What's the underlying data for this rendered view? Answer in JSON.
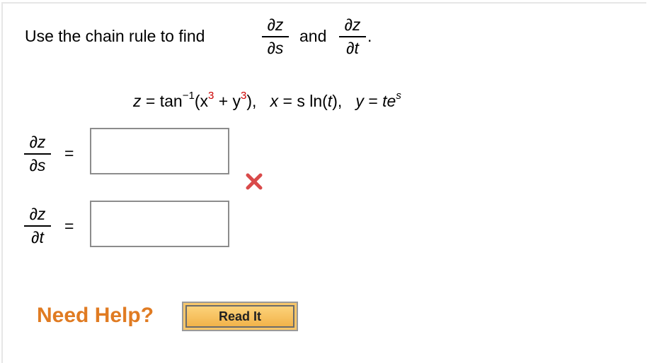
{
  "question": {
    "prompt_before": "Use the chain rule to find",
    "connector": "and",
    "period": ".",
    "frac_ds": {
      "num": "∂z",
      "den": "∂s"
    },
    "frac_dt": {
      "num": "∂z",
      "den": "∂t"
    }
  },
  "equation": {
    "z_lhs": "z",
    "eq": "=",
    "tan": "tan",
    "inv": "−1",
    "open": "(x",
    "exp_x": "3",
    "plus": "+ y",
    "exp_y": "3",
    "close": "),",
    "x_def_var": "x",
    "x_def_rhs": "= s ln(",
    "x_def_t": "t",
    "x_def_end": "),",
    "y_def_var": "y",
    "y_def_eq": "= ",
    "y_def_te": "te",
    "y_def_exp": "s"
  },
  "answers": [
    {
      "label_num": "∂z",
      "label_den": "∂s",
      "equals": "=",
      "value": "",
      "status": "incorrect"
    },
    {
      "label_num": "∂z",
      "label_den": "∂t",
      "equals": "=",
      "value": "",
      "status": "none"
    }
  ],
  "help": {
    "need_help_label": "Need Help?",
    "read_it_label": "Read It"
  },
  "colors": {
    "accent_orange": "#e07b22",
    "incorrect_red": "#d94a4a",
    "exponent_red": "#cc0000"
  }
}
